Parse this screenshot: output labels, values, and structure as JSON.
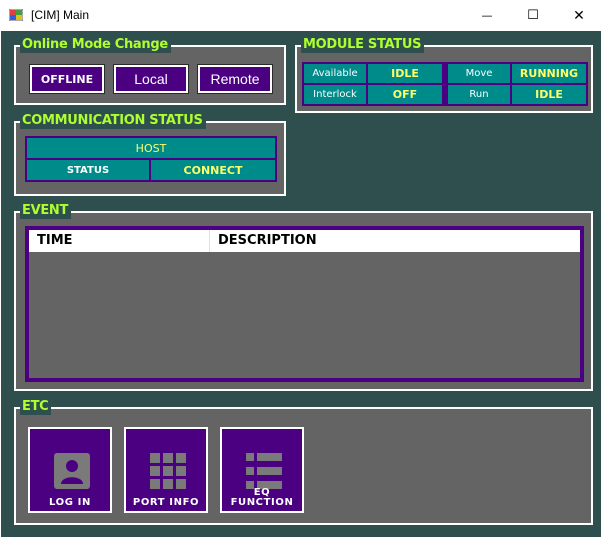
{
  "window": {
    "title": "[CIM] Main",
    "minimize_glyph": "—",
    "maximize_glyph": "☐",
    "close_glyph": "✕"
  },
  "online_mode": {
    "title": "Online Mode Change",
    "buttons": [
      "OFFLINE",
      "Local",
      "Remote"
    ]
  },
  "module_status": {
    "title": "MODULE STATUS",
    "rows": [
      {
        "label1": "Available",
        "value1": "IDLE",
        "label2": "Move",
        "value2": "RUNNING"
      },
      {
        "label1": "Interlock",
        "value1": "OFF",
        "label2": "Run",
        "value2": "IDLE"
      }
    ]
  },
  "communication_status": {
    "title": "COMMUNICATION STATUS",
    "host": "HOST",
    "status_label": "STATUS",
    "status_value": "CONNECT"
  },
  "event": {
    "title": "EVENT",
    "columns": [
      "TIME",
      "DESCRIPTION"
    ],
    "rows": []
  },
  "etc": {
    "title": "ETC",
    "tiles": [
      {
        "label": "LOG IN",
        "icon": "user-icon"
      },
      {
        "label": "PORT INFO",
        "icon": "grid-icon"
      },
      {
        "label": "EQ\nFUNCTION",
        "icon": "list-icon"
      }
    ]
  },
  "colors": {
    "background": "#2f4f4f",
    "group_fill": "#646464",
    "accent_title": "#adff2f",
    "button_fill": "#4b0082",
    "cell_fill": "#008b8b",
    "value_text": "#ffff66"
  }
}
